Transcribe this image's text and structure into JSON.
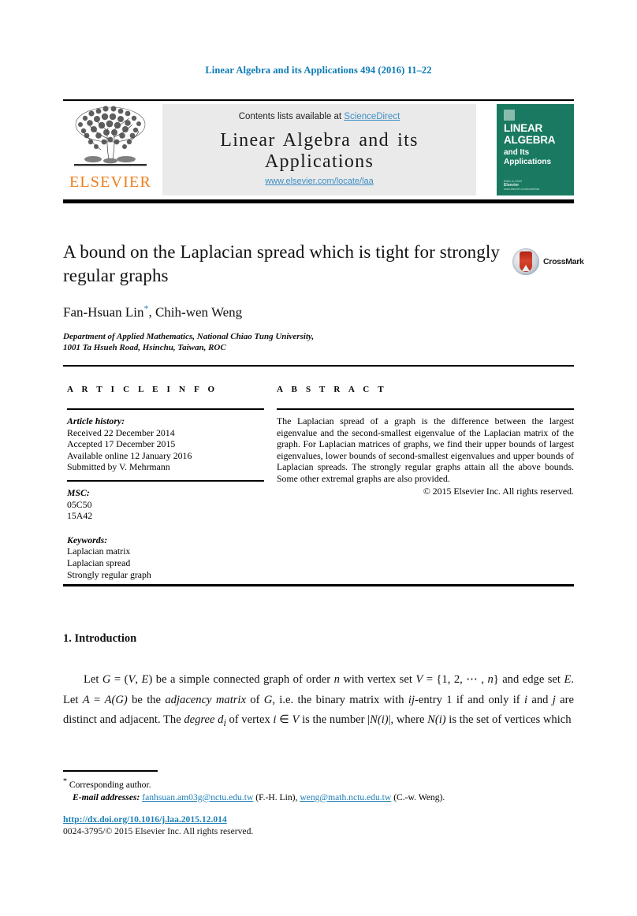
{
  "running_head": "Linear Algebra and its Applications 494 (2016) 11–22",
  "masthead": {
    "contents_prefix": "Contents lists available at ",
    "sciencedirect": "ScienceDirect",
    "journal_name": "Linear Algebra and its Applications",
    "journal_url": "www.elsevier.com/locate/laa",
    "publisher": "ELSEVIER",
    "cover": {
      "title_line1": "LINEAR",
      "title_line2": "ALGEBRA",
      "sub_line1": "and Its",
      "sub_line2": "Applications",
      "foot_small": "Editor-in-Chief",
      "foot_bold": "Elsevier",
      "foot_tiny": "www.elsevier.com/locate/laa"
    },
    "accent_link_color": "#3c8fc4",
    "cover_color": "#197a61",
    "elsevier_orange": "#ef7d1a"
  },
  "article": {
    "title": "A bound on the Laplacian spread which is tight for strongly regular graphs",
    "authors": "Fan-Hsuan Lin",
    "authors_star": "*",
    "authors_rest": ", Chih-wen Weng",
    "affiliation_line1": "Department of Applied Mathematics, National Chiao Tung University,",
    "affiliation_line2": "1001 Ta Hsueh Road, Hsinchu, Taiwan, ROC",
    "crossmark_label": "CrossMark"
  },
  "info": {
    "heading": "A R T I C L E   I N F O",
    "history_label": "Article history:",
    "history": [
      "Received 22 December 2014",
      "Accepted 17 December 2015",
      "Available online 12 January 2016",
      "Submitted by V. Mehrmann"
    ],
    "msc_label": "MSC:",
    "msc": [
      "05C50",
      "15A42"
    ],
    "keywords_label": "Keywords:",
    "keywords": [
      "Laplacian matrix",
      "Laplacian spread",
      "Strongly regular graph"
    ]
  },
  "abstract": {
    "heading": "A B S T R A C T",
    "text": "The Laplacian spread of a graph is the difference between the largest eigenvalue and the second-smallest eigenvalue of the Laplacian matrix of the graph. For Laplacian matrices of graphs, we find their upper bounds of largest eigenvalues, lower bounds of second-smallest eigenvalues and upper bounds of Laplacian spreads. The strongly regular graphs attain all the above bounds. Some other extremal graphs are also provided.",
    "copyright": "© 2015 Elsevier Inc. All rights reserved."
  },
  "body": {
    "section_number_title": "1.  Introduction",
    "paragraph_parts": {
      "p1": "Let ",
      "G": "G",
      "p2": " = (",
      "V": "V",
      "p3": ", ",
      "E": "E",
      "p4": ") be a simple connected graph of order ",
      "n": "n",
      "p5": " with vertex set ",
      "V2": "V",
      "p6": " = {1, 2, ⋯ , ",
      "n2": "n",
      "p7": "} and edge set ",
      "E2": "E",
      "p8": ". Let ",
      "A": "A",
      "p9": " = ",
      "AG": "A(G)",
      "p10": " be the ",
      "adjmat": "adjacency matrix",
      "p11": " of ",
      "G2": "G",
      "p12": ", i.e. the binary matrix with ",
      "ij": "ij",
      "p13": "-entry 1 if and only if ",
      "i": "i",
      "p14": " and ",
      "j": "j",
      "p15": " are distinct and adjacent. The ",
      "degree": "degree",
      "p16": " ",
      "di": "d",
      "di_sub": "i",
      "p17": " of vertex ",
      "i2": "i",
      "p18": " ∈ ",
      "V3": "V",
      "p19": " is the number |",
      "Ni": "N(i)",
      "p20": "|, where ",
      "Ni2": "N(i)",
      "p21": " is the set of vertices which"
    }
  },
  "footnotes": {
    "corresponding_star": "*",
    "corresponding_text": "Corresponding author.",
    "email_label": "E-mail addresses:",
    "email1": "fanhsuan.am03g@nctu.edu.tw",
    "email1_owner": "(F.-H. Lin),",
    "email2": "weng@math.nctu.edu.tw",
    "email2_owner": "(C.-w. Weng).",
    "doi": "http://dx.doi.org/10.1016/j.laa.2015.12.014",
    "issn": "0024-3795/© 2015 Elsevier Inc. All rights reserved."
  }
}
